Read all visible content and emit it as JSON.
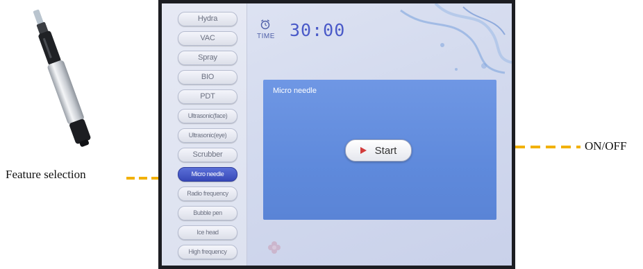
{
  "annotations": {
    "feature_selection": "Feature selection",
    "on_off": "ON/OFF"
  },
  "timer": {
    "caption": "TIME",
    "value": "30:00"
  },
  "menu": {
    "items": [
      {
        "label": "Hydra"
      },
      {
        "label": "VAC"
      },
      {
        "label": "Spray"
      },
      {
        "label": "BIO"
      },
      {
        "label": "PDT"
      },
      {
        "label": "Ultrasonic(face)"
      },
      {
        "label": "Ultrasonic(eye)"
      },
      {
        "label": "Scrubber"
      },
      {
        "label": "Micro needle"
      },
      {
        "label": "Radio frequency"
      },
      {
        "label": "Bubble pen"
      },
      {
        "label": "Ice head"
      },
      {
        "label": "High frequency"
      }
    ],
    "active_index": 8
  },
  "panel": {
    "title": "Micro needle",
    "start_label": "Start"
  },
  "colors": {
    "arrow": "#f2b100",
    "panel": "#6f97e4",
    "active_item": "#3f52c4",
    "timer": "#4a5ac8"
  }
}
